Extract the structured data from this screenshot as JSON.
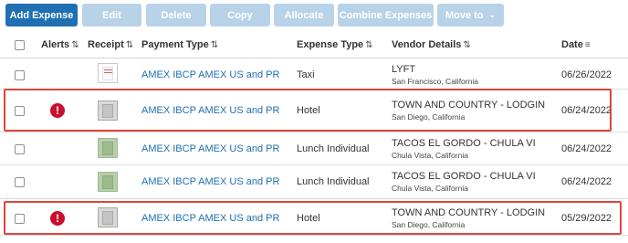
{
  "toolbar": {
    "add_expense": "Add Expense",
    "edit": "Edit",
    "delete": "Delete",
    "copy": "Copy",
    "allocate": "Allocate",
    "combine_expenses": "Combine Expenses",
    "move_to": "Move to",
    "move_to_chevron": "⌄"
  },
  "header": {
    "alerts": "Alerts",
    "receipt": "Receipt",
    "payment_type": "Payment Type",
    "expense_type": "Expense Type",
    "vendor_details": "Vendor Details",
    "date": "Date",
    "sort_glyph": "⇅",
    "date_sort_glyph": "≡"
  },
  "rows": [
    {
      "alert": false,
      "receipt": "doc",
      "payment_type": "AMEX IBCP AMEX US and PR",
      "expense_type": "Taxi",
      "vendor": "LYFT",
      "location": "San Francisco, California",
      "date": "06/26/2022"
    },
    {
      "alert": true,
      "alert_glyph": "!",
      "receipt": "gray",
      "payment_type": "AMEX IBCP AMEX US and PR",
      "expense_type": "Hotel",
      "vendor": "TOWN AND COUNTRY - LODGIN",
      "location": "San Diego, California",
      "date": "06/24/2022"
    },
    {
      "alert": false,
      "receipt": "green",
      "payment_type": "AMEX IBCP AMEX US and PR",
      "expense_type": "Lunch Individual",
      "vendor": "TACOS EL GORDO - CHULA VI",
      "location": "Chula Vista, California",
      "date": "06/24/2022"
    },
    {
      "alert": false,
      "receipt": "green",
      "payment_type": "AMEX IBCP AMEX US and PR",
      "expense_type": "Lunch Individual",
      "vendor": "TACOS EL GORDO - CHULA VI",
      "location": "Chula Vista, California",
      "date": "06/24/2022"
    },
    {
      "alert": true,
      "alert_glyph": "!",
      "receipt": "gray",
      "payment_type": "AMEX IBCP AMEX US and PR",
      "expense_type": "Hotel",
      "vendor": "TOWN AND COUNTRY - LODGIN",
      "location": "San Diego, California",
      "date": "05/29/2022"
    }
  ],
  "colors": {
    "primary": "#1f6fb2",
    "disabled": "#b8d2e8",
    "alert": "#c8102e",
    "highlight_border": "#e0453a"
  }
}
